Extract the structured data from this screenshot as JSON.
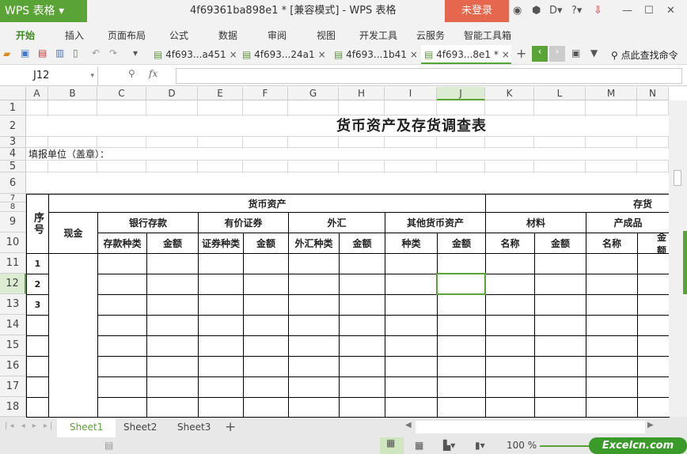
{
  "app": {
    "logo": "WPS 表格",
    "title": "4f69361ba898e1 * [兼容模式] - WPS 表格",
    "login": "未登录"
  },
  "menu": [
    "开始",
    "插入",
    "页面布局",
    "公式",
    "数据",
    "审阅",
    "视图",
    "开发工具",
    "云服务",
    "智能工具箱"
  ],
  "tabs": [
    "4f693...a451",
    "4f693...24a1",
    "4f693...1b41",
    "4f693...8e1 *"
  ],
  "search_label": "点此查找命令",
  "namebox": "J12",
  "fx": "fx",
  "columns": [
    "A",
    "B",
    "C",
    "D",
    "E",
    "F",
    "G",
    "H",
    "I",
    "J",
    "K",
    "L",
    "M",
    "N"
  ],
  "rows": [
    "1",
    "2",
    "3",
    "4",
    "5",
    "6",
    "7",
    "8",
    "9",
    "10",
    "11",
    "12",
    "13",
    "14",
    "15",
    "16",
    "17",
    "18"
  ],
  "sheet": {
    "title": "货币资产及存货调查表",
    "unit": "填报单位（盖章）：",
    "seq": "序号",
    "monetary": "货币资产",
    "inventory": "存货",
    "cash": "现金",
    "groups": [
      "银行存款",
      "有价证券",
      "外汇",
      "其他货币资产",
      "材料",
      "产成品"
    ],
    "subheaders": [
      "存款种类",
      "金额",
      "证券种类",
      "金额",
      "外汇种类",
      "金额",
      "种类",
      "金额",
      "名称",
      "金额",
      "名称",
      "金额"
    ],
    "seq_values": [
      "1",
      "2",
      "3"
    ]
  },
  "sheets": [
    "Sheet1",
    "Sheet2",
    "Sheet3"
  ],
  "zoom": "100 %",
  "watermark": "Excelcn.com",
  "colors": {
    "accent": "#5aa336",
    "login": "#e5674e"
  }
}
